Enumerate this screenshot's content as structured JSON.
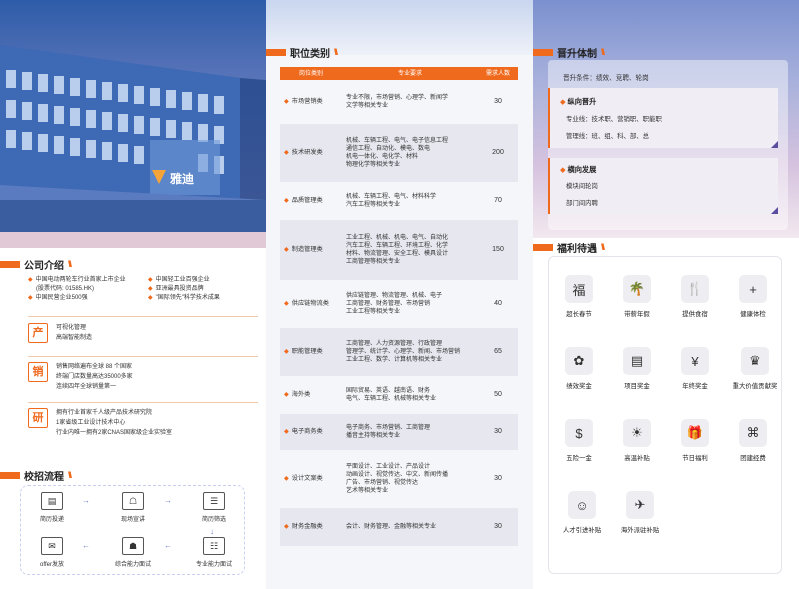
{
  "brand": {
    "logo_text": "雅迪"
  },
  "intro": {
    "title": "公司介绍",
    "bullets_left": [
      "中国电动两轮车行业首家上市企业",
      "(股票代码: 01585.HK)",
      "中国民营企业500强"
    ],
    "bullets_right": [
      "中国轻工业百强企业",
      "亚洲最具投资品牌",
      "\"国际领先\"科学技术成果"
    ],
    "features": [
      {
        "badge": "产",
        "lines": [
          "可视化管理",
          "高端智能制造"
        ]
      },
      {
        "badge": "销",
        "lines": [
          "销售网络遍布全球 88 个国家",
          "终端门店数量高达35000多家",
          "连续四年全球销量第一"
        ]
      },
      {
        "badge": "研",
        "lines": [
          "拥有行业首家千人级产品技术研究院",
          "1家省级工业设计技术中心",
          "行业内唯一拥有2家CNAS国家级企业实验室"
        ]
      }
    ]
  },
  "campus": {
    "title": "校招流程",
    "steps": [
      "简历投递",
      "现场宣讲",
      "简历筛选",
      "专业能力面试",
      "综合能力面试",
      "offer发放"
    ]
  },
  "jobs": {
    "title": "职位类别",
    "headers": [
      "岗位类别",
      "专业要求",
      "需求人数"
    ],
    "rows": [
      {
        "name": "市场营销类",
        "req": [
          "专业不限，市场营销、心理学、新闻学",
          "文学等相关专业"
        ],
        "num": "30"
      },
      {
        "name": "技术研发类",
        "req": [
          "机械、车辆工程、电气、电子信息工程",
          "通信工程、自动化、模电、数电",
          "机电一体化、电化学、材料",
          "物理化学等相关专业"
        ],
        "num": "200"
      },
      {
        "name": "品质管理类",
        "req": [
          "机械、车辆工程、电气、材料科学",
          "汽车工程等相关专业"
        ],
        "num": "70"
      },
      {
        "name": "制造管理类",
        "req": [
          "工业工程、机械、机电、电气、自动化",
          "汽车工程、车辆工程、环境工程、化学",
          "材料、物流管理、安全工程、模具设计",
          "工商管理等相关专业"
        ],
        "num": "150"
      },
      {
        "name": "供应链物流类",
        "req": [
          "供应链管理、物流管理、机械、电子",
          "工商管理、财务管理、市场营销",
          "工业工程等相关专业"
        ],
        "num": "40"
      },
      {
        "name": "职能管理类",
        "req": [
          "工商管理、人力资源管理、行政管理",
          "管理学、统计学、心理学、新闻、市场营销",
          "工业工程、数学、计算机等相关专业"
        ],
        "num": "65"
      },
      {
        "name": "海外类",
        "req": [
          "国际贸易、英语、越南语、财务",
          "电气、车辆工程、机械等相关专业"
        ],
        "num": "50"
      },
      {
        "name": "电子商务类",
        "req": [
          "电子商务、市场营销、工商管理",
          "播音主持等相关专业"
        ],
        "num": "30"
      },
      {
        "name": "设计文案类",
        "req": [
          "平面设计、工业设计、产品设计",
          "动画设计、视觉传达、中文、新闻传播",
          "广告、市场营销、视觉传达",
          "艺术等相关专业"
        ],
        "num": "30"
      },
      {
        "name": "财务金融类",
        "req": [
          "会计、财务管理、金融等相关专业"
        ],
        "num": "30"
      }
    ]
  },
  "promotion": {
    "title": "晋升体制",
    "conditions": "晋升条件：绩效、竞聘、轮岗",
    "vertical": {
      "title": "纵向晋升",
      "lines": [
        "专业线：技术职、营销职、职能职",
        "管理线：班、组、科、部、总"
      ]
    },
    "horizontal": {
      "title": "横向发展",
      "lines": [
        "模块间轮岗",
        "部门间内聘"
      ]
    }
  },
  "benefits": {
    "title": "福利待遇",
    "items": [
      {
        "label": "超长春节",
        "icon": "福"
      },
      {
        "label": "带薪年假",
        "icon": "🌴"
      },
      {
        "label": "提供食宿",
        "icon": "🍴"
      },
      {
        "label": "健康体检",
        "icon": "+"
      },
      {
        "label": "绩效奖金",
        "icon": "✿"
      },
      {
        "label": "项目奖金",
        "icon": "▤"
      },
      {
        "label": "年终奖金",
        "icon": "¥"
      },
      {
        "label": "重大价值贡献奖",
        "icon": "♛"
      },
      {
        "label": "五险一金",
        "icon": "$"
      },
      {
        "label": "高温补贴",
        "icon": "☀"
      },
      {
        "label": "节日福利",
        "icon": "🎁"
      },
      {
        "label": "团建经费",
        "icon": "⌘"
      },
      {
        "label": "人才引进补贴",
        "icon": "☺"
      },
      {
        "label": "海外派驻补贴",
        "icon": "✈"
      }
    ]
  }
}
